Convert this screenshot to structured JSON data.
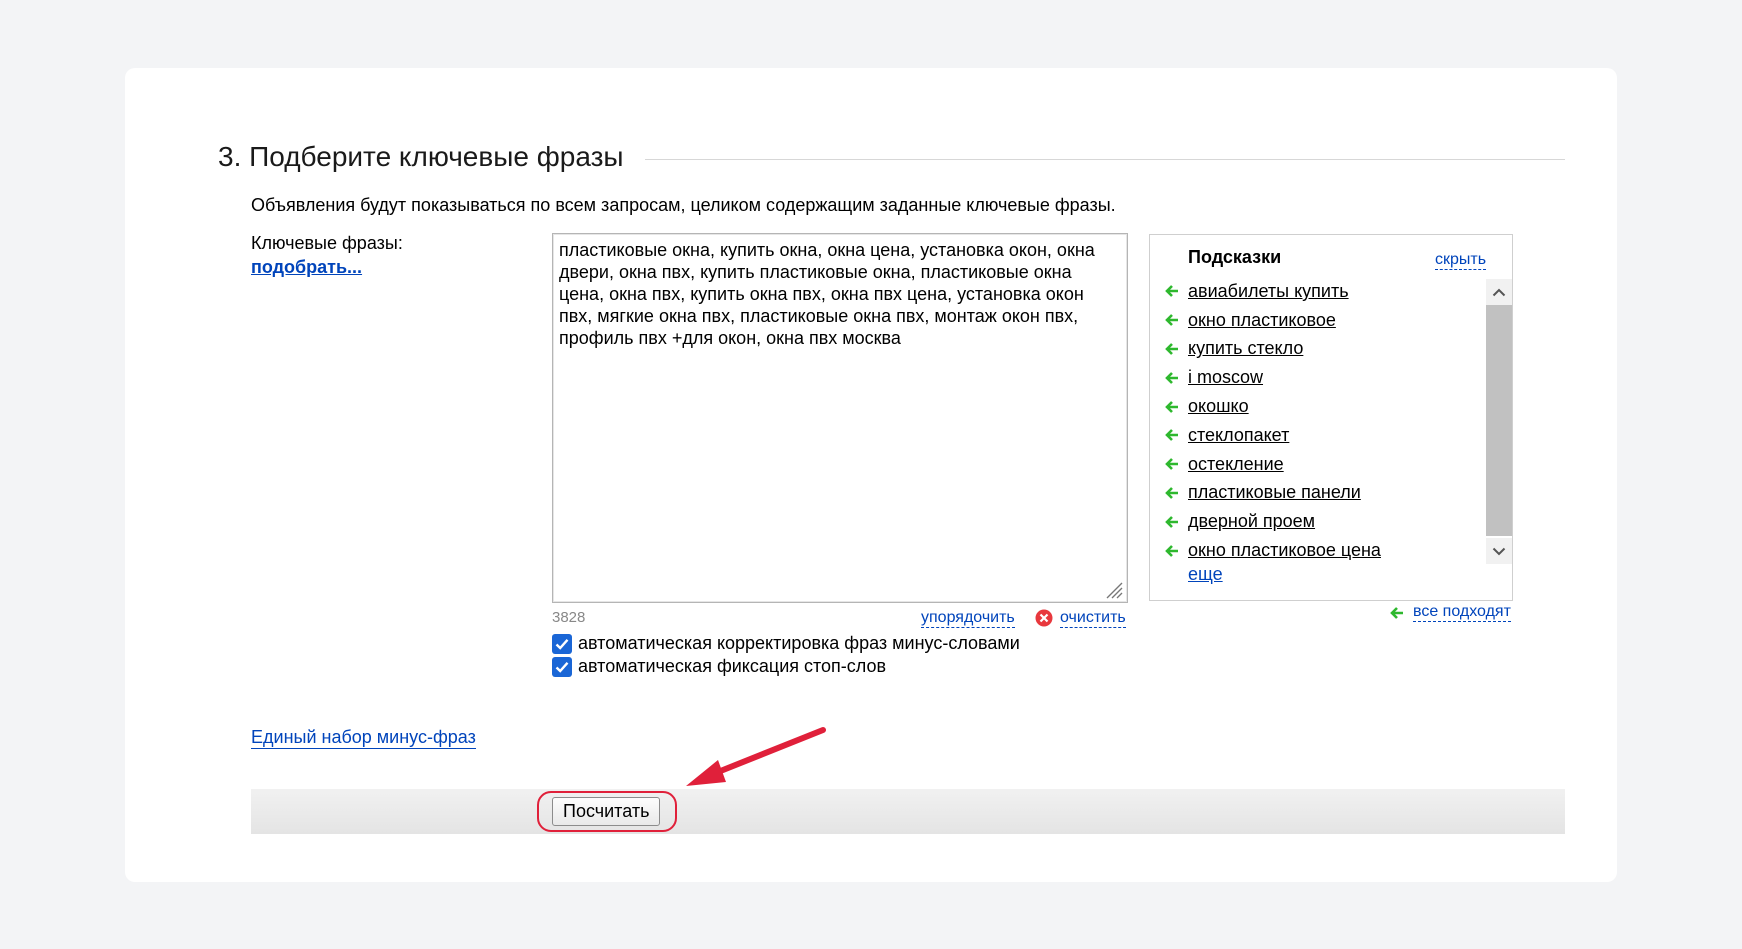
{
  "section": {
    "title": "3. Подберите ключевые фразы",
    "info": "Объявления будут показываться по всем запросам, целиком содержащим заданные ключевые фразы."
  },
  "keywords": {
    "label": "Ключевые фразы:",
    "pick_link": "подобрать...",
    "text": "пластиковые окна, купить окна, окна цена, установка окон, окна двери, окна пвх, купить пластиковые окна, пластиковые окна цена, окна пвх, купить окна пвх, окна пвх цена, установка окон пвх, мягкие окна пвх, пластиковые окна пвх, монтаж окон пвх, профиль пвх +для окон, окна пвх москва",
    "counter": "3828",
    "order_link": "упорядочить",
    "clear_link": "очистить",
    "checkbox_autocorrect": "автоматическая корректировка фраз минус-словами",
    "checkbox_stopwords": "автоматическая фиксация стоп-слов"
  },
  "hints": {
    "title": "Подсказки",
    "hide_link": "скрыть",
    "items": [
      "авиабилеты купить",
      "окно пластиковое",
      "купить стекло",
      "i moscow",
      "окошко",
      "стеклопакет",
      "остекление",
      "пластиковые панели",
      "дверной проем",
      "окно пластиковое цена"
    ],
    "more_link": "еще",
    "all_link": "все подходят"
  },
  "minus_phrases_link": "Единый набор минус-фраз",
  "calc_button": "Посчитать",
  "colors": {
    "link": "#0044bb",
    "checkbox": "#1a66d6",
    "hint_arrow": "#2eb82e",
    "annotation": "#e0203a"
  }
}
